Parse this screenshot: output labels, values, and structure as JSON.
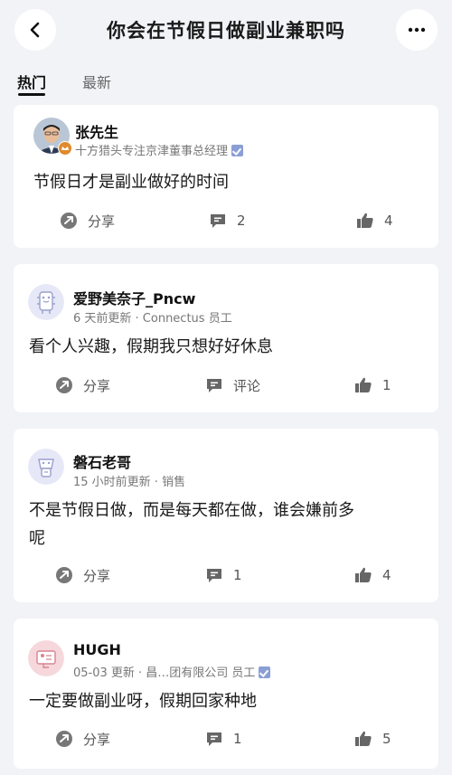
{
  "header": {
    "title": "你会在节假日做副业兼职吗"
  },
  "tabs": [
    {
      "label": "热门"
    },
    {
      "label": "最新"
    }
  ],
  "posts": [
    {
      "name": "张先生",
      "meta": "十方猎头专注京津董事总经理",
      "content": "节假日才是副业做好的时间",
      "share": "分享",
      "comments": "2",
      "likes": "4",
      "avatar": "photo-avatar"
    },
    {
      "name": "爱野美奈子_Pncw",
      "meta": "6 天前更新 · Connectus 员工",
      "content": "看个人兴趣，假期我只想好好休息",
      "share": "分享",
      "comments": "评论",
      "likes": "1",
      "avatar": "robot-avatar"
    },
    {
      "name": "磐石老哥",
      "meta": "15 小时前更新 · 销售",
      "content_line1": "不是节假日做，而是每天都在做，谁会嫌前多",
      "content_line2": "呢",
      "share": "分享",
      "comments": "1",
      "likes": "4",
      "avatar": "robot-avatar"
    },
    {
      "name": "HUGH",
      "meta": "05-03 更新 · 昌…团有限公司  员工",
      "content": "一定要做副业呀，假期回家种地",
      "share": "分享",
      "comments": "1",
      "likes": "5",
      "avatar": "card-avatar"
    }
  ],
  "colors": {
    "background": "#f2f3f7",
    "card": "#ffffff",
    "verified": "#8a9fd6",
    "avatar_lavender": "#e7e8f7",
    "avatar_pink": "#f6d8dc"
  }
}
